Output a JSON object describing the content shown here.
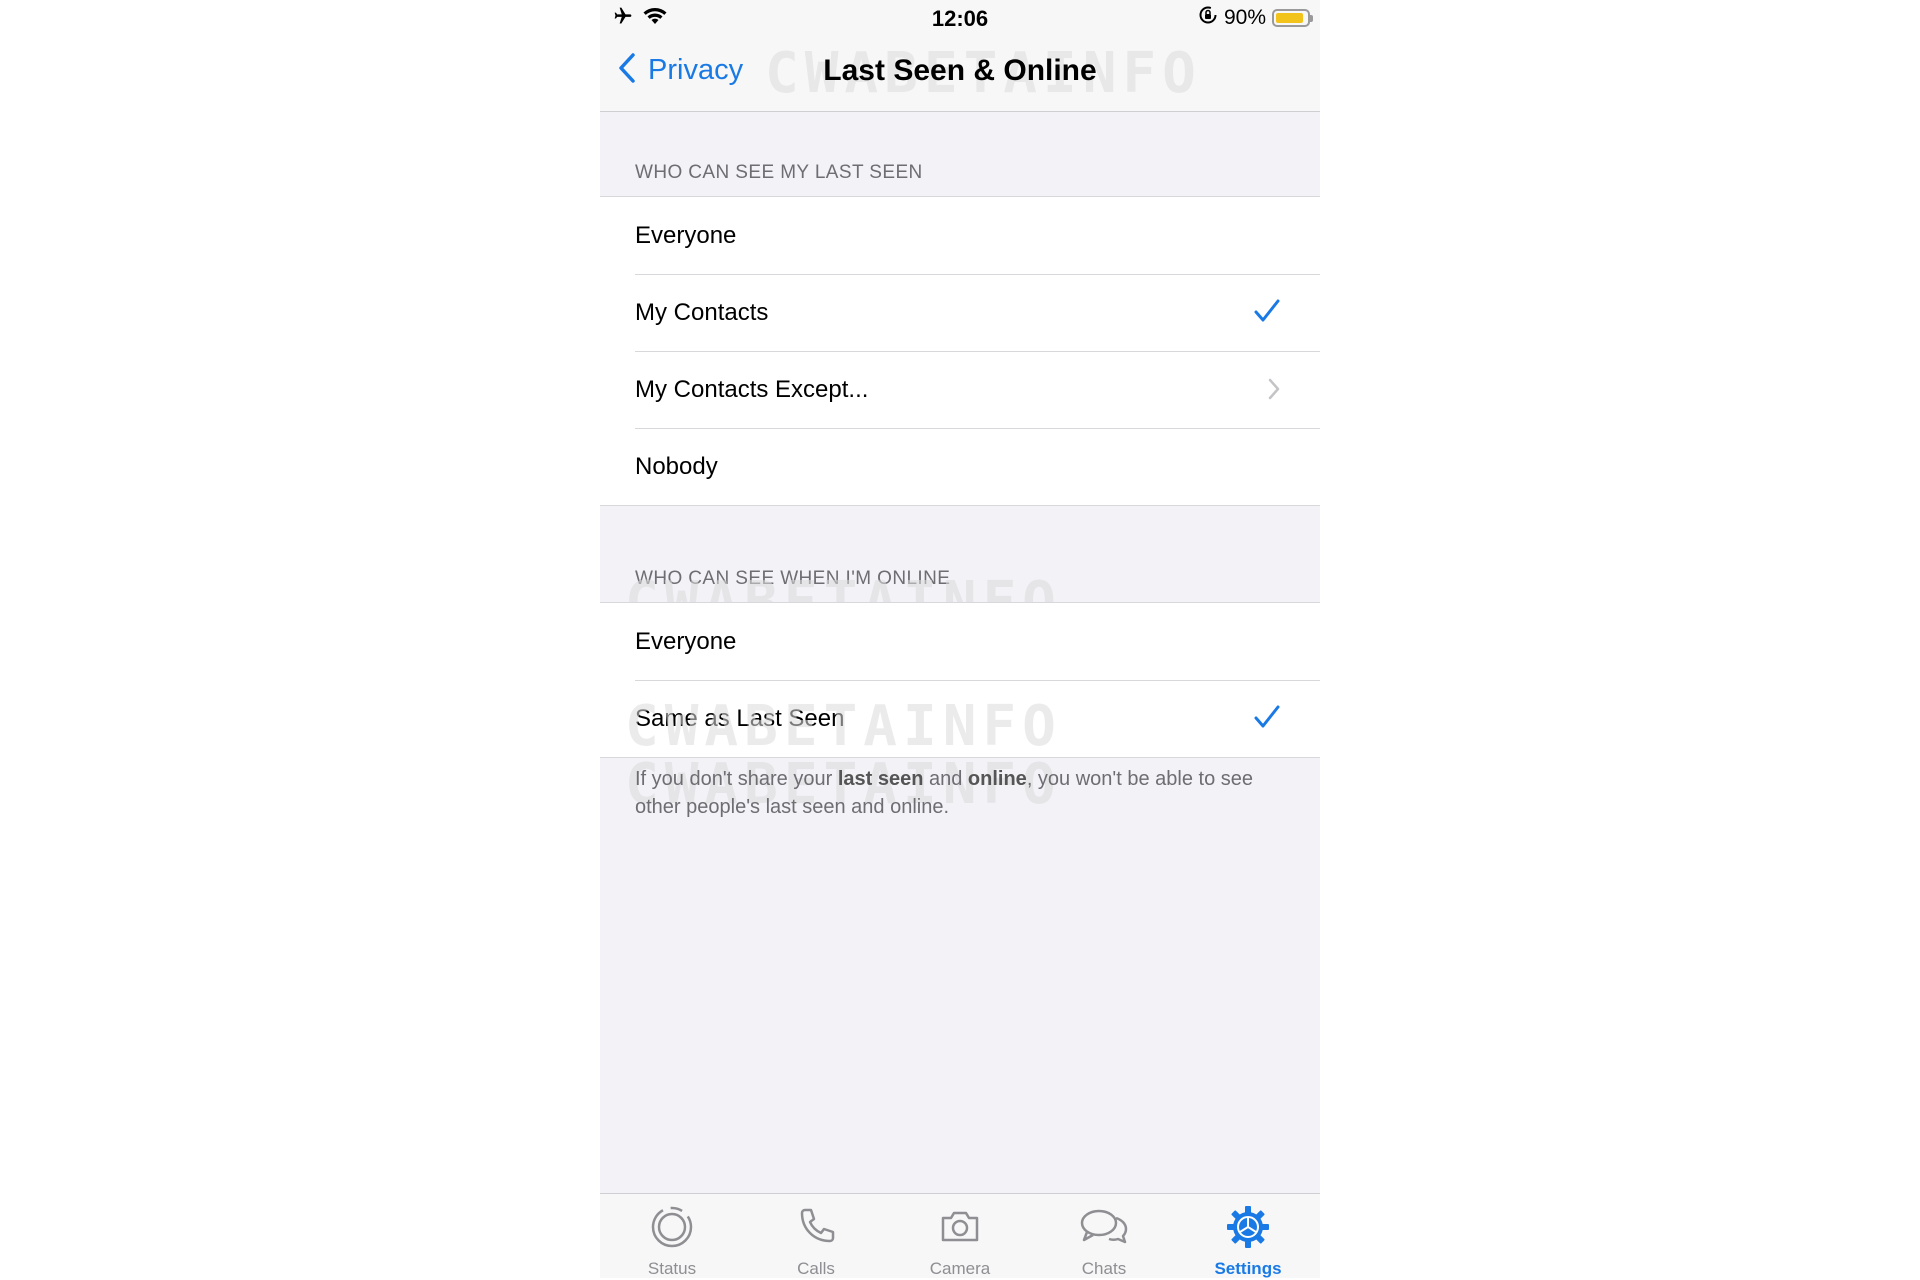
{
  "status_bar": {
    "time": "12:06",
    "battery_text": "90%",
    "battery_level": 0.9,
    "icons": [
      "airplane-icon",
      "wifi-icon",
      "orientation-lock-icon",
      "battery-icon"
    ]
  },
  "nav": {
    "back_label": "Privacy",
    "title": "Last Seen & Online"
  },
  "watermark": "CWABETAINFO",
  "last_seen": {
    "header": "WHO CAN SEE MY LAST SEEN",
    "options": [
      {
        "label": "Everyone",
        "selected": false
      },
      {
        "label": "My Contacts",
        "selected": true
      },
      {
        "label": "My Contacts Except...",
        "selected": false,
        "disclosure": true
      },
      {
        "label": "Nobody",
        "selected": false
      }
    ]
  },
  "online": {
    "header": "WHO CAN SEE WHEN I'M ONLINE",
    "options": [
      {
        "label": "Everyone",
        "selected": false
      },
      {
        "label": "Same as Last Seen",
        "selected": true
      }
    ],
    "footer": {
      "part1": "If you don't share your ",
      "bold1": "last seen",
      "part2": " and ",
      "bold2": "online",
      "part3": ", you won't be able to see other people's last seen and online."
    }
  },
  "tabbar": {
    "tabs": [
      {
        "label": "Status",
        "icon": "status-icon",
        "active": false
      },
      {
        "label": "Calls",
        "icon": "phone-icon",
        "active": false
      },
      {
        "label": "Camera",
        "icon": "camera-icon",
        "active": false
      },
      {
        "label": "Chats",
        "icon": "chats-icon",
        "active": false
      },
      {
        "label": "Settings",
        "icon": "gear-icon",
        "active": true
      }
    ]
  },
  "colors": {
    "accent": "#1a7ae5",
    "background": "#f2f2f7",
    "battery": "#f2c31b"
  }
}
